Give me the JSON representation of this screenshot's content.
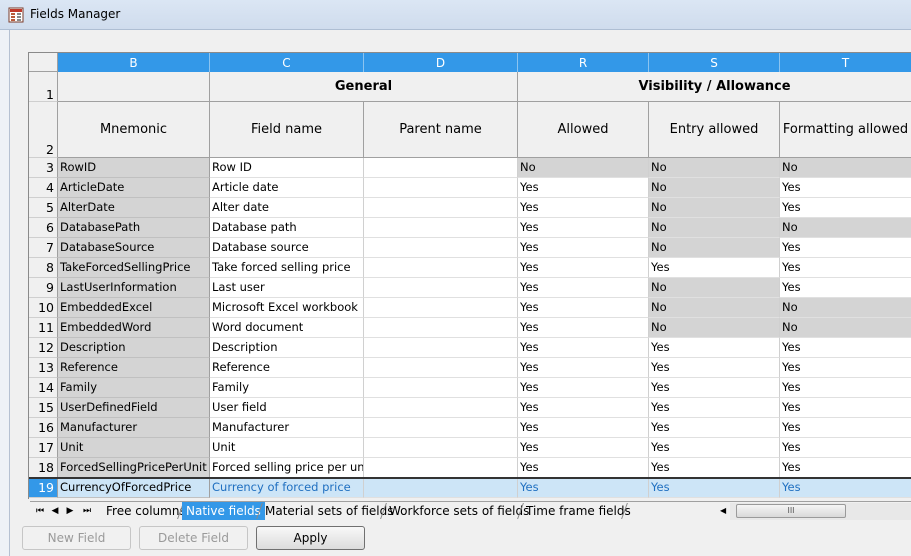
{
  "window": {
    "title": "Fields Manager"
  },
  "columns": {
    "B": "B",
    "C": "C",
    "D": "D",
    "R": "R",
    "S": "S",
    "T": "T"
  },
  "header_rows": {
    "row1_num": "1",
    "row2_num": "2",
    "general": "General",
    "visibility": "Visibility / Allowance",
    "mnemonic": "Mnemonic",
    "field_name": "Field name",
    "parent_name": "Parent name",
    "allowed": "Allowed",
    "entry_allowed": "Entry allowed",
    "formatting_allowed": "Formatting allowed"
  },
  "rows": [
    {
      "num": "3",
      "mnemonic": "RowID",
      "field": "Row ID",
      "parent": "",
      "allowed": "No",
      "entry": "No",
      "fmt": "No"
    },
    {
      "num": "4",
      "mnemonic": "ArticleDate",
      "field": "Article date",
      "parent": "",
      "allowed": "Yes",
      "entry": "No",
      "fmt": "Yes"
    },
    {
      "num": "5",
      "mnemonic": "AlterDate",
      "field": "Alter date",
      "parent": "",
      "allowed": "Yes",
      "entry": "No",
      "fmt": "Yes"
    },
    {
      "num": "6",
      "mnemonic": "DatabasePath",
      "field": "Database path",
      "parent": "",
      "allowed": "Yes",
      "entry": "No",
      "fmt": "No"
    },
    {
      "num": "7",
      "mnemonic": "DatabaseSource",
      "field": "Database source",
      "parent": "",
      "allowed": "Yes",
      "entry": "No",
      "fmt": "Yes"
    },
    {
      "num": "8",
      "mnemonic": "TakeForcedSellingPrice",
      "field": "Take forced selling price",
      "parent": "",
      "allowed": "Yes",
      "entry": "Yes",
      "fmt": "Yes"
    },
    {
      "num": "9",
      "mnemonic": "LastUserInformation",
      "field": "Last user",
      "parent": "",
      "allowed": "Yes",
      "entry": "No",
      "fmt": "Yes"
    },
    {
      "num": "10",
      "mnemonic": "EmbeddedExcel",
      "field": "Microsoft Excel workbook",
      "parent": "",
      "allowed": "Yes",
      "entry": "No",
      "fmt": "No"
    },
    {
      "num": "11",
      "mnemonic": "EmbeddedWord",
      "field": "Word document",
      "parent": "",
      "allowed": "Yes",
      "entry": "No",
      "fmt": "No"
    },
    {
      "num": "12",
      "mnemonic": "Description",
      "field": "Description",
      "parent": "",
      "allowed": "Yes",
      "entry": "Yes",
      "fmt": "Yes"
    },
    {
      "num": "13",
      "mnemonic": "Reference",
      "field": "Reference",
      "parent": "",
      "allowed": "Yes",
      "entry": "Yes",
      "fmt": "Yes"
    },
    {
      "num": "14",
      "mnemonic": "Family",
      "field": "Family",
      "parent": "",
      "allowed": "Yes",
      "entry": "Yes",
      "fmt": "Yes"
    },
    {
      "num": "15",
      "mnemonic": "UserDefinedField",
      "field": "User field",
      "parent": "",
      "allowed": "Yes",
      "entry": "Yes",
      "fmt": "Yes"
    },
    {
      "num": "16",
      "mnemonic": "Manufacturer",
      "field": "Manufacturer",
      "parent": "",
      "allowed": "Yes",
      "entry": "Yes",
      "fmt": "Yes"
    },
    {
      "num": "17",
      "mnemonic": "Unit",
      "field": "Unit",
      "parent": "",
      "allowed": "Yes",
      "entry": "Yes",
      "fmt": "Yes"
    },
    {
      "num": "18",
      "mnemonic": "ForcedSellingPricePerUnit",
      "field": "Forced selling price per uni",
      "parent": "",
      "allowed": "Yes",
      "entry": "Yes",
      "fmt": "Yes"
    },
    {
      "num": "19",
      "mnemonic": "CurrencyOfForcedPrice",
      "field": "Currency of forced price",
      "parent": "",
      "allowed": "Yes",
      "entry": "Yes",
      "fmt": "Yes"
    }
  ],
  "selected_row": "19",
  "sheet_tabs": [
    "Free columns",
    "Native fields",
    "Material sets of fields",
    "Workforce sets of fields",
    "Time frame fields"
  ],
  "active_tab": "Native fields",
  "nav_icons": [
    "first-sheet-icon",
    "prev-sheet-icon",
    "next-sheet-icon",
    "last-sheet-icon"
  ],
  "scroll_grip": "III",
  "buttons": {
    "new_field": "New Field",
    "delete_field": "Delete Field",
    "apply": "Apply"
  },
  "colors": {
    "accent": "#3398e8",
    "locked_cell": "#d4d4d4",
    "selected_row": "#cde5f7"
  }
}
